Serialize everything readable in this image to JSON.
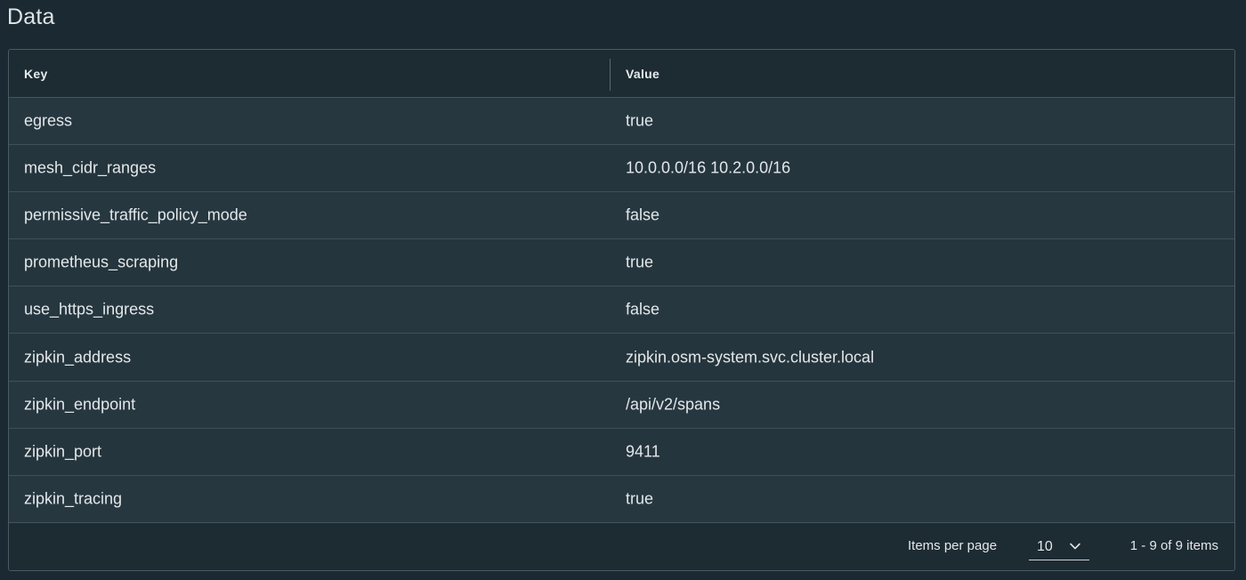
{
  "page": {
    "title": "Data"
  },
  "table": {
    "columns": [
      "Key",
      "Value"
    ],
    "rows": [
      {
        "key": "egress",
        "value": "true"
      },
      {
        "key": "mesh_cidr_ranges",
        "value": "10.0.0.0/16 10.2.0.0/16"
      },
      {
        "key": "permissive_traffic_policy_mode",
        "value": "false"
      },
      {
        "key": "prometheus_scraping",
        "value": "true"
      },
      {
        "key": "use_https_ingress",
        "value": "false"
      },
      {
        "key": "zipkin_address",
        "value": "zipkin.osm-system.svc.cluster.local"
      },
      {
        "key": "zipkin_endpoint",
        "value": "/api/v2/spans"
      },
      {
        "key": "zipkin_port",
        "value": "9411"
      },
      {
        "key": "zipkin_tracing",
        "value": "true"
      }
    ]
  },
  "footer": {
    "items_per_page_label": "Items per page",
    "items_per_page_value": "10",
    "range_text": "1 - 9 of 9 items",
    "select_icon": "chevron-down-icon"
  },
  "colors": {
    "background": "#1b2a32",
    "row": "#25353d",
    "border": "#45565e",
    "text": "#e3e7e9"
  }
}
